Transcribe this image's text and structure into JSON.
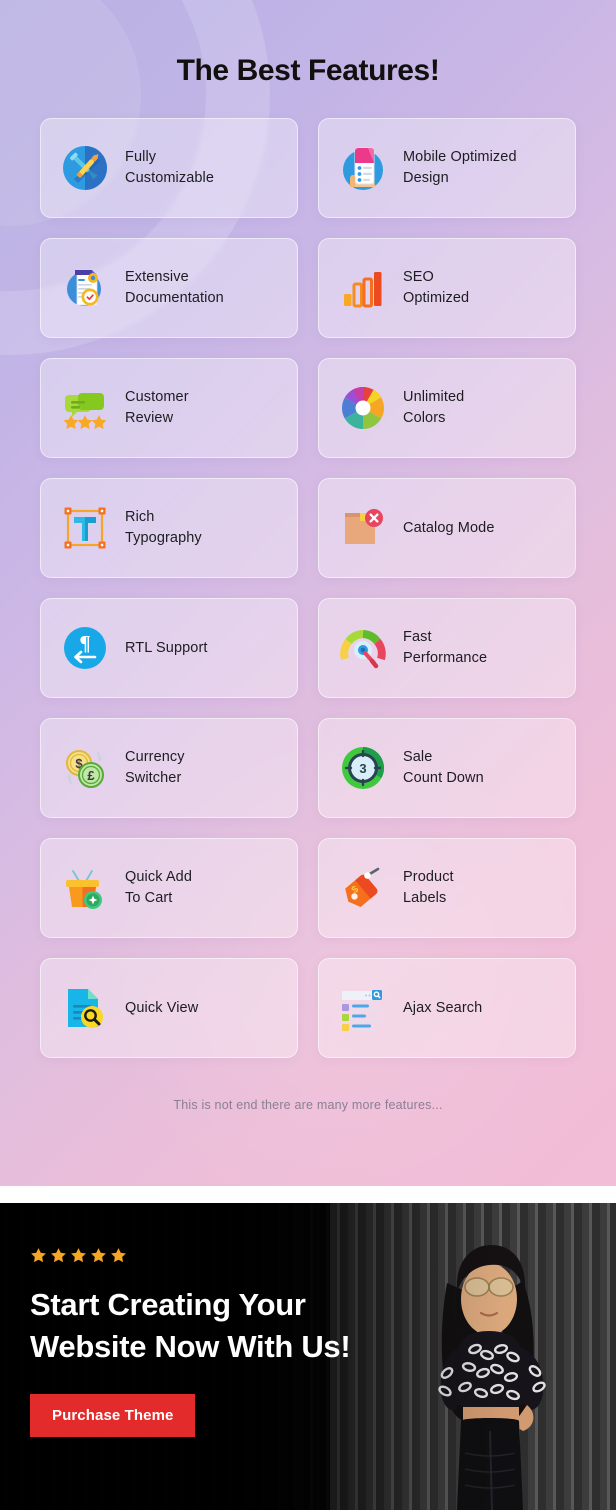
{
  "features_section": {
    "title": "The Best Features!",
    "footnote": "This is not end there are many more features...",
    "cards": [
      {
        "label": "Fully\nCustomizable",
        "icon": "tools-circle-icon"
      },
      {
        "label": "Mobile Optimized\nDesign",
        "icon": "mobile-phone-hand-icon"
      },
      {
        "label": "Extensive\nDocumentation",
        "icon": "document-gear-icon"
      },
      {
        "label": "SEO\nOptimized",
        "icon": "bar-chart-icon"
      },
      {
        "label": "Customer\nReview",
        "icon": "speech-bubbles-stars-icon"
      },
      {
        "label": "Unlimited\nColors",
        "icon": "color-wheel-icon"
      },
      {
        "label": "Rich\nTypography",
        "icon": "text-selection-icon"
      },
      {
        "label": "Catalog Mode",
        "icon": "catalog-disabled-icon"
      },
      {
        "label": "RTL Support",
        "icon": "rtl-pilcrow-icon"
      },
      {
        "label": "Fast\nPerformance",
        "icon": "speedometer-icon"
      },
      {
        "label": "Currency\nSwitcher",
        "icon": "currency-coins-icon"
      },
      {
        "label": "Sale\nCount Down",
        "icon": "countdown-timer-icon"
      },
      {
        "label": "Quick Add\nTo Cart",
        "icon": "shopping-basket-plus-icon"
      },
      {
        "label": "Product\nLabels",
        "icon": "price-tag-icon"
      },
      {
        "label": "Quick View",
        "icon": "document-magnifier-icon"
      },
      {
        "label": "Ajax Search",
        "icon": "search-results-icon"
      }
    ]
  },
  "cta_section": {
    "star_count": 5,
    "heading": "Start Creating Your\nWebsite Now With Us!",
    "button_label": "Purchase Theme"
  },
  "colors": {
    "gradient_start": "#b6aee4",
    "gradient_end": "#f2bdd6",
    "title_text": "#11100f",
    "card_text": "#1d1d21",
    "footnote_text": "#8a7f93",
    "cta_background": "#0a0a0a",
    "cta_heading": "#ffffff",
    "button_background": "#e32b2b",
    "star_gold": "#f5a623"
  }
}
